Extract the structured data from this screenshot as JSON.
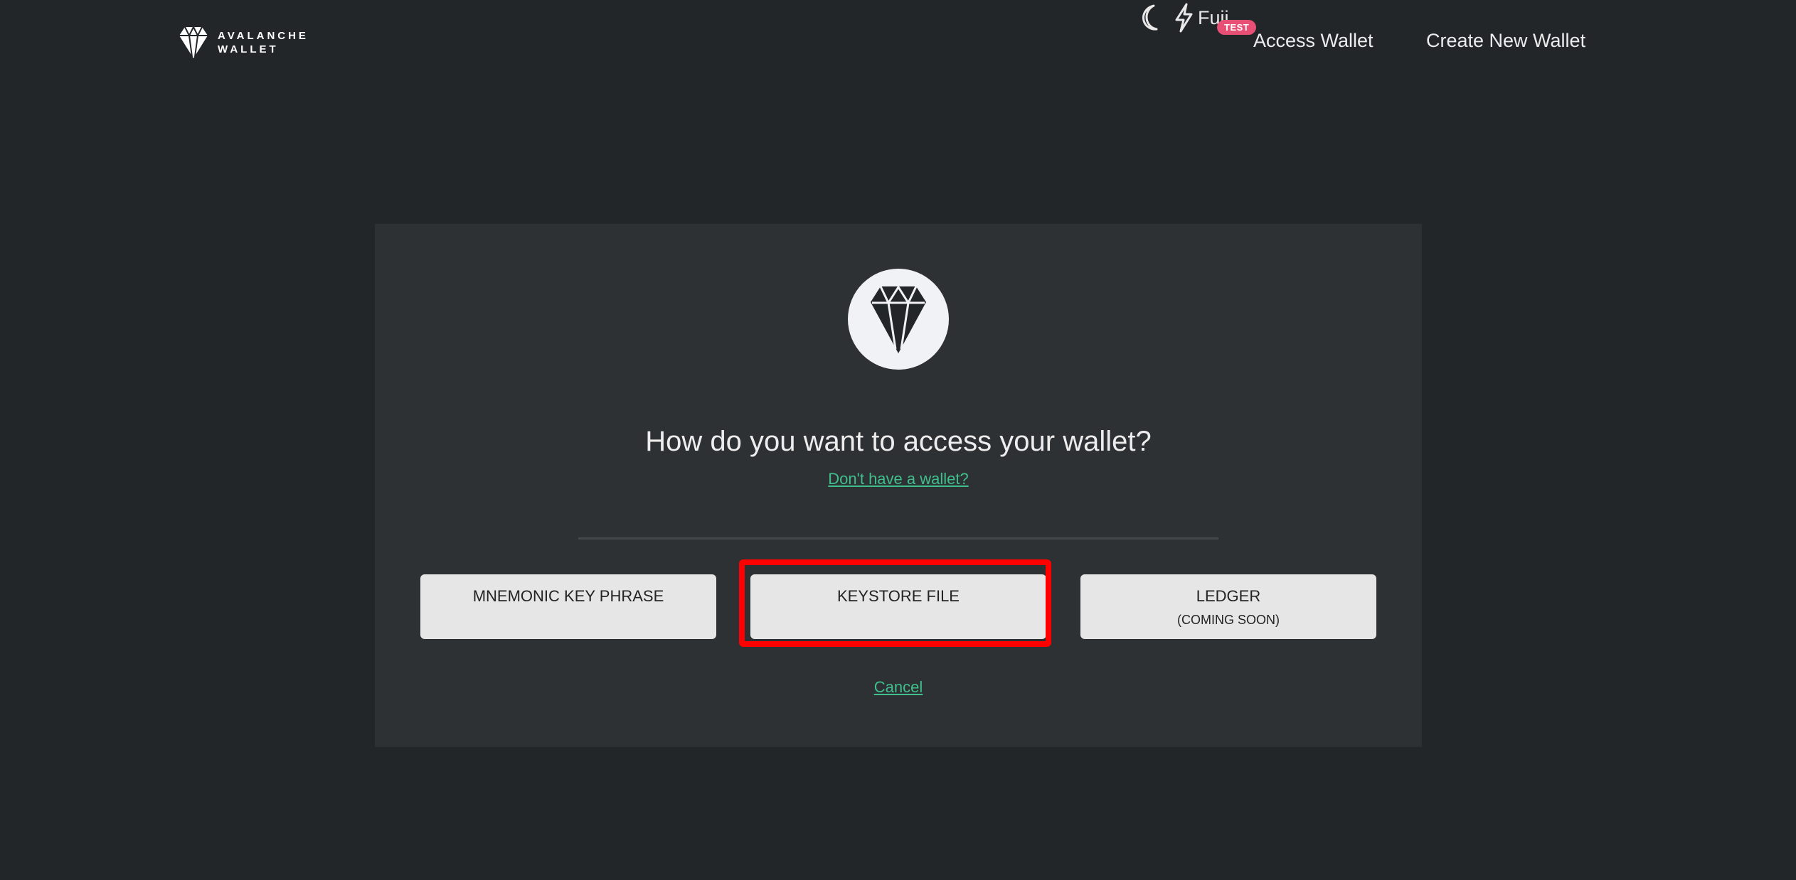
{
  "header": {
    "logo_line1": "AVALANCHE",
    "logo_line2": "WALLET",
    "network_name": "Fuji",
    "network_badge": "TEST",
    "access_wallet": "Access Wallet",
    "create_wallet": "Create New Wallet",
    "icons": [
      "diamond-logo-icon",
      "moon-icon",
      "lightning-icon"
    ]
  },
  "card": {
    "question": "How do you want to access your wallet?",
    "no_wallet_link": "Don't have a wallet?",
    "options": [
      {
        "title": "MNEMONIC KEY PHRASE",
        "subtitle": ""
      },
      {
        "title": "KEYSTORE FILE",
        "subtitle": ""
      },
      {
        "title": "LEDGER",
        "subtitle": "(COMING SOON)"
      }
    ],
    "cancel": "Cancel"
  },
  "colors": {
    "background": "#232629",
    "card": "#2e3134",
    "link": "#3fbf8c",
    "badge": "#e84f74",
    "highlight": "#ff0000"
  }
}
